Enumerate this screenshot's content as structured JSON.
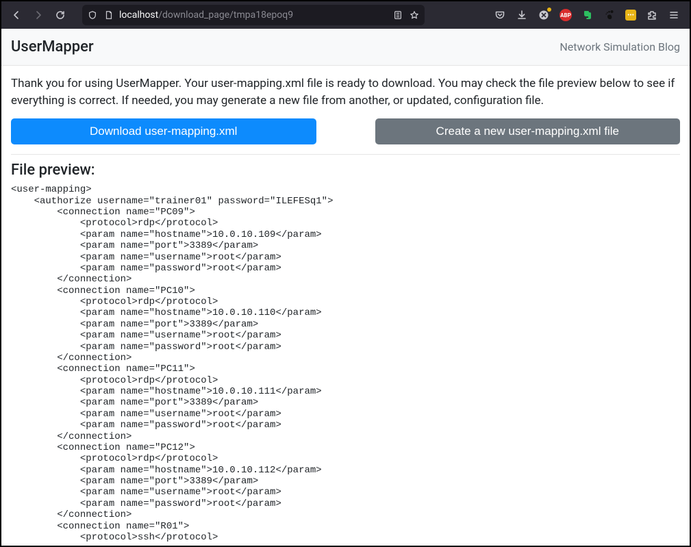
{
  "browser": {
    "url_host": "localhost",
    "url_path": "/download_page/tmpa18epoq9"
  },
  "header": {
    "title": "UserMapper",
    "subtitle": "Network Simulation Blog"
  },
  "intro": "Thank you for using UserMapper. Your user-mapping.xml file is ready to download. You may check the file preview below to see if everything is correct. If needed, you may generate a new file from another, or updated, configuration file.",
  "buttons": {
    "download": "Download user-mapping.xml",
    "create": "Create a new user-mapping.xml file"
  },
  "preview_heading": "File preview:",
  "file_preview": "<user-mapping>\n    <authorize username=\"trainer01\" password=\"ILEFESq1\">\n        <connection name=\"PC09\">\n            <protocol>rdp</protocol>\n            <param name=\"hostname\">10.0.10.109</param>\n            <param name=\"port\">3389</param>\n            <param name=\"username\">root</param>\n            <param name=\"password\">root</param>\n        </connection>\n        <connection name=\"PC10\">\n            <protocol>rdp</protocol>\n            <param name=\"hostname\">10.0.10.110</param>\n            <param name=\"port\">3389</param>\n            <param name=\"username\">root</param>\n            <param name=\"password\">root</param>\n        </connection>\n        <connection name=\"PC11\">\n            <protocol>rdp</protocol>\n            <param name=\"hostname\">10.0.10.111</param>\n            <param name=\"port\">3389</param>\n            <param name=\"username\">root</param>\n            <param name=\"password\">root</param>\n        </connection>\n        <connection name=\"PC12\">\n            <protocol>rdp</protocol>\n            <param name=\"hostname\">10.0.10.112</param>\n            <param name=\"port\">3389</param>\n            <param name=\"username\">root</param>\n            <param name=\"password\">root</param>\n        </connection>\n        <connection name=\"R01\">\n            <protocol>ssh</protocol>"
}
